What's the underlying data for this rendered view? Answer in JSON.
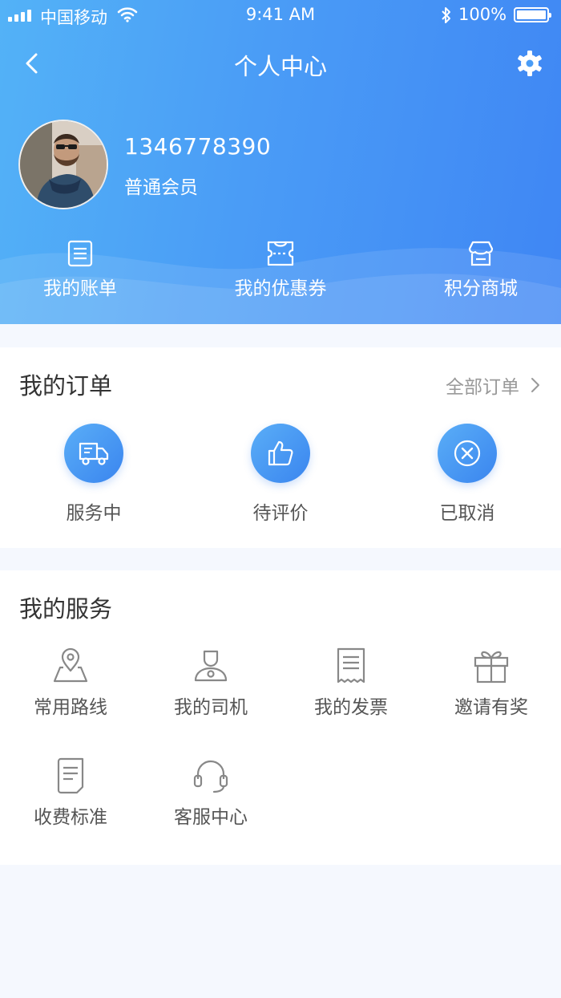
{
  "status_bar": {
    "carrier": "中国移动",
    "time": "9:41 AM",
    "battery": "100%"
  },
  "nav": {
    "title": "个人中心"
  },
  "user": {
    "phone": "1346778390",
    "level": "普通会员"
  },
  "quick_links": [
    {
      "label": "我的账单",
      "icon": "bill-icon"
    },
    {
      "label": "我的优惠券",
      "icon": "coupon-icon"
    },
    {
      "label": "积分商城",
      "icon": "store-icon"
    }
  ],
  "orders": {
    "title": "我的订单",
    "more": "全部订单",
    "items": [
      {
        "label": "服务中",
        "icon": "truck-icon"
      },
      {
        "label": "待评价",
        "icon": "thumbs-up-icon"
      },
      {
        "label": "已取消",
        "icon": "cancel-icon"
      }
    ]
  },
  "services": {
    "title": "我的服务",
    "items": [
      {
        "label": "常用路线",
        "icon": "map-pin-icon"
      },
      {
        "label": "我的司机",
        "icon": "driver-icon"
      },
      {
        "label": "我的发票",
        "icon": "invoice-icon"
      },
      {
        "label": "邀请有奖",
        "icon": "gift-icon"
      },
      {
        "label": "收费标准",
        "icon": "document-icon"
      },
      {
        "label": "客服中心",
        "icon": "headset-icon"
      }
    ]
  },
  "colors": {
    "header_start": "#53b2f7",
    "header_end": "#3f86f4",
    "accent": "#3a85ef",
    "background": "#f5f8fe"
  }
}
